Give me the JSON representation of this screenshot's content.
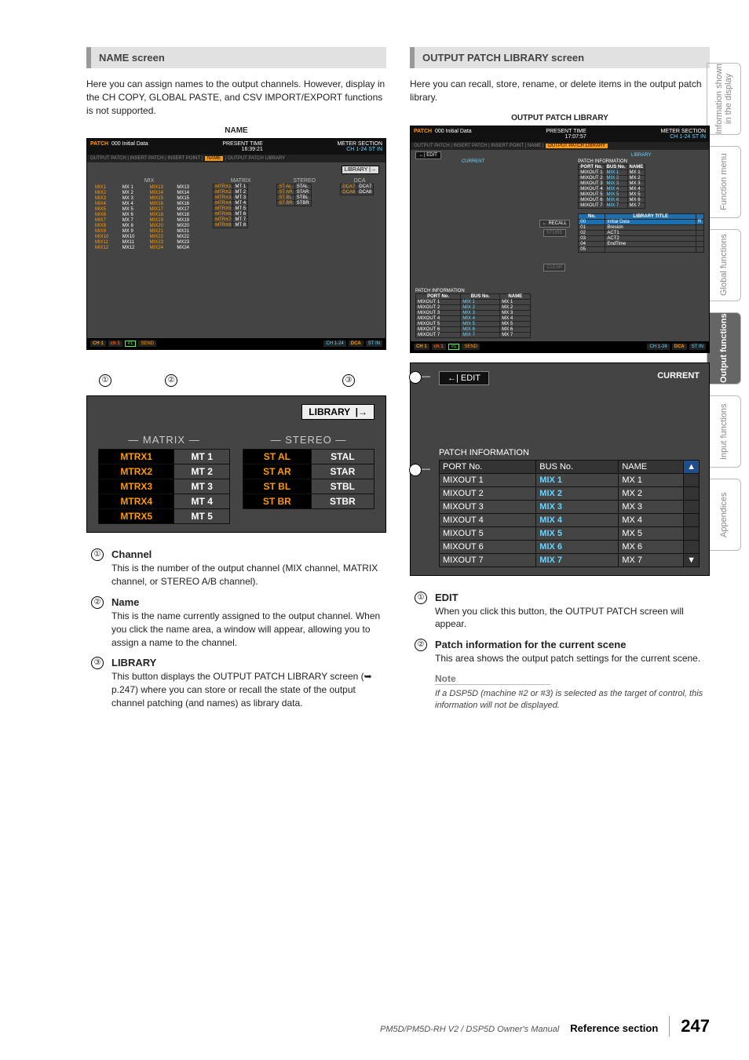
{
  "sideTabs": [
    "Information shown in the display",
    "Function menu",
    "Global functions",
    "Output functions",
    "Input functions",
    "Appendices"
  ],
  "sideActiveIndex": 3,
  "footer": {
    "manual": "PM5D/PM5D-RH V2 / DSP5D Owner's Manual",
    "section": "Reference section",
    "page": "247"
  },
  "left": {
    "heading": "NAME screen",
    "intro": "Here you can assign names to the output channels. However, display in the CH COPY, GLOBAL PASTE, and CSV IMPORT/EXPORT functions is not supported.",
    "caption": "NAME",
    "scr": {
      "patchLabel": "PATCH",
      "scene": "000 Initial Data",
      "presentTimeLbl": "PRESENT TIME",
      "time": "16:39:21",
      "meterLbl": "METER SECTION",
      "meter1": "CH 1-24",
      "meter2": "ST IN",
      "tabs": "OUTPUT PATCH | INSERT PATCH | INSERT POINT |",
      "tabActive": "NAME",
      "tabsAfter": "| OUTPUT PATCH LIBRARY",
      "libraryBtn": "LIBRARY",
      "mixLbl": "MIX",
      "matrixLbl": "MATRIX",
      "stereoLbl": "STEREO",
      "dcaLbl": "DCA",
      "mix": [
        [
          "MIX1",
          "MX 1",
          "MIX13",
          "MX13"
        ],
        [
          "MIX2",
          "MX 2",
          "MIX14",
          "MX14"
        ],
        [
          "MIX3",
          "MX 3",
          "MIX15",
          "MX15"
        ],
        [
          "MIX4",
          "MX 4",
          "MIX16",
          "MX16"
        ],
        [
          "MIX5",
          "MX 5",
          "MIX17",
          "MX17"
        ],
        [
          "MIX6",
          "MX 6",
          "MIX18",
          "MX18"
        ],
        [
          "MIX7",
          "MX 7",
          "MIX19",
          "MX19"
        ],
        [
          "MIX8",
          "MX 8",
          "MIX20",
          "MX20"
        ],
        [
          "MIX9",
          "MX 9",
          "MIX21",
          "MX21"
        ],
        [
          "MIX10",
          "MX10",
          "MIX22",
          "MX22"
        ],
        [
          "MIX11",
          "MX11",
          "MIX23",
          "MX23"
        ],
        [
          "MIX12",
          "MX12",
          "MIX24",
          "MX24"
        ]
      ],
      "matrix": [
        [
          "MTRX1",
          "MT 1"
        ],
        [
          "MTRX2",
          "MT 2"
        ],
        [
          "MTRX3",
          "MT 3"
        ],
        [
          "MTRX4",
          "MT 4"
        ],
        [
          "MTRX5",
          "MT 5"
        ],
        [
          "MTRX6",
          "MT 6"
        ],
        [
          "MTRX7",
          "MT 7"
        ],
        [
          "MTRX8",
          "MT 8"
        ]
      ],
      "stereo": [
        [
          "ST AL",
          "STAL"
        ],
        [
          "ST AR",
          "STAR"
        ],
        [
          "ST BL",
          "STBL"
        ],
        [
          "ST BR",
          "STBR"
        ]
      ],
      "dca": [
        [
          "DCA7",
          "DCA7"
        ],
        [
          "DCA8",
          "DCA8"
        ]
      ],
      "footer": {
        "ch": "CH 1",
        "chLow": "ch 1",
        "machine": "#1",
        "send": "SEND",
        "input": "CH 1-24",
        "dca": "DCA",
        "stin": "ST IN"
      }
    },
    "zoom": {
      "libraryBtn": "LIBRARY",
      "matrixHdr": "MATRIX",
      "stereoHdr": "STEREO",
      "matrix": [
        [
          "MTRX1",
          "MT 1"
        ],
        [
          "MTRX2",
          "MT 2"
        ],
        [
          "MTRX3",
          "MT 3"
        ],
        [
          "MTRX4",
          "MT 4"
        ],
        [
          "MTRX5",
          "MT 5"
        ]
      ],
      "stereo": [
        [
          "ST AL",
          "STAL"
        ],
        [
          "ST AR",
          "STAR"
        ],
        [
          "ST BL",
          "STBL"
        ],
        [
          "ST BR",
          "STBR"
        ]
      ]
    },
    "items": [
      {
        "num": "①",
        "name": "Channel",
        "text": "This is the number of the output channel (MIX channel, MATRIX channel, or STEREO A/B channel)."
      },
      {
        "num": "②",
        "name": "Name",
        "text": "This is the name currently assigned to the output channel. When you click the name area, a window will appear, allowing you to assign a name to the channel."
      },
      {
        "num": "③",
        "name": "LIBRARY",
        "text": "This button displays the OUTPUT PATCH LIBRARY screen (➥ p.247) where you can store or recall the state of the output channel patching (and names) as library data."
      }
    ]
  },
  "right": {
    "heading": "OUTPUT PATCH LIBRARY screen",
    "intro": "Here you can recall, store, rename, or delete items in the output patch library.",
    "caption": "OUTPUT PATCH LIBRARY",
    "scr": {
      "patchLabel": "PATCH",
      "scene": "000 Initial Data",
      "presentTimeLbl": "PRESENT TIME",
      "time": "17:07:57",
      "meterLbl": "METER SECTION",
      "meter1": "CH 1-24",
      "meter2": "ST IN",
      "tabs": "OUTPUT PATCH | INSERT PATCH | INSERT POINT | NAME |",
      "tabActive": "OUTPUT PATCH LIBRARY",
      "editBtn": "EDIT",
      "currentLbl": "CURRENT",
      "libraryLbl": "LIBRARY",
      "piTitle": "PATCH INFORMATION",
      "piCols": [
        "PORT No.",
        "BUS No.",
        "NAME"
      ],
      "piCurrent": [
        [
          "MIXOUT 1",
          "MIX 1",
          "MX 1"
        ],
        [
          "MIXOUT 2",
          "MIX 2",
          "MX 2"
        ],
        [
          "MIXOUT 3",
          "MIX 3",
          "MX 3"
        ],
        [
          "MIXOUT 4",
          "MIX 4",
          "MX 4"
        ],
        [
          "MIXOUT 5",
          "MIX 5",
          "MX 5"
        ],
        [
          "MIXOUT 6",
          "MIX 6",
          "MX 6"
        ],
        [
          "MIXOUT 7",
          "MIX 7",
          "MX 7"
        ]
      ],
      "piLib": [
        [
          "MIXOUT 1",
          "MIX 1",
          "MX 1"
        ],
        [
          "MIXOUT 2",
          "MIX 2",
          "MX 2"
        ],
        [
          "MIXOUT 3",
          "MIX 3",
          "MX 3"
        ],
        [
          "MIXOUT 4",
          "MIX 4",
          "MX 4"
        ],
        [
          "MIXOUT 5",
          "MIX 5",
          "MX 5"
        ],
        [
          "MIXOUT 6",
          "MIX 6",
          "MX 6"
        ],
        [
          "MIXOUT 7",
          "MIX 7",
          "MX 7"
        ]
      ],
      "recallBtn": "RECALL",
      "storeBtn": "STORE",
      "clearBtn": "CLEAR",
      "libListHdr": [
        "No.",
        "LIBRARY TITLE",
        ""
      ],
      "libList": [
        [
          "00",
          "Initial Data",
          "R"
        ],
        [
          "01",
          "Bresion",
          ""
        ],
        [
          "02",
          "ACT1",
          ""
        ],
        [
          "03",
          "ACT2",
          ""
        ],
        [
          "04",
          "EndTime",
          ""
        ],
        [
          "05",
          "",
          ""
        ]
      ],
      "footer": {
        "ch": "CH 1",
        "chLow": "ch 1",
        "machine": "#1",
        "send": "SEND",
        "input": "CH 1-24",
        "dca": "DCA",
        "stin": "ST IN"
      }
    },
    "zoom": {
      "editBtn": "EDIT",
      "currentLbl": "CURRENT",
      "piTitle": "PATCH INFORMATION",
      "cols": [
        "PORT No.",
        "BUS No.",
        "NAME"
      ],
      "rows": [
        [
          "MIXOUT 1",
          "MIX 1",
          "MX 1"
        ],
        [
          "MIXOUT 2",
          "MIX 2",
          "MX 2"
        ],
        [
          "MIXOUT 3",
          "MIX 3",
          "MX 3"
        ],
        [
          "MIXOUT 4",
          "MIX 4",
          "MX 4"
        ],
        [
          "MIXOUT 5",
          "MIX 5",
          "MX 5"
        ],
        [
          "MIXOUT 6",
          "MIX 6",
          "MX 6"
        ],
        [
          "MIXOUT 7",
          "MIX 7",
          "MX 7"
        ]
      ]
    },
    "items": [
      {
        "num": "①",
        "name": "EDIT",
        "text": "When you click this button, the OUTPUT PATCH screen will appear."
      },
      {
        "num": "②",
        "name": "Patch information for the current scene",
        "text": "This area shows the output patch settings for the current scene."
      }
    ],
    "note": {
      "hdr": "Note",
      "body": "If a DSP5D (machine #2 or #3) is selected as the target of control, this information will not be displayed."
    }
  }
}
